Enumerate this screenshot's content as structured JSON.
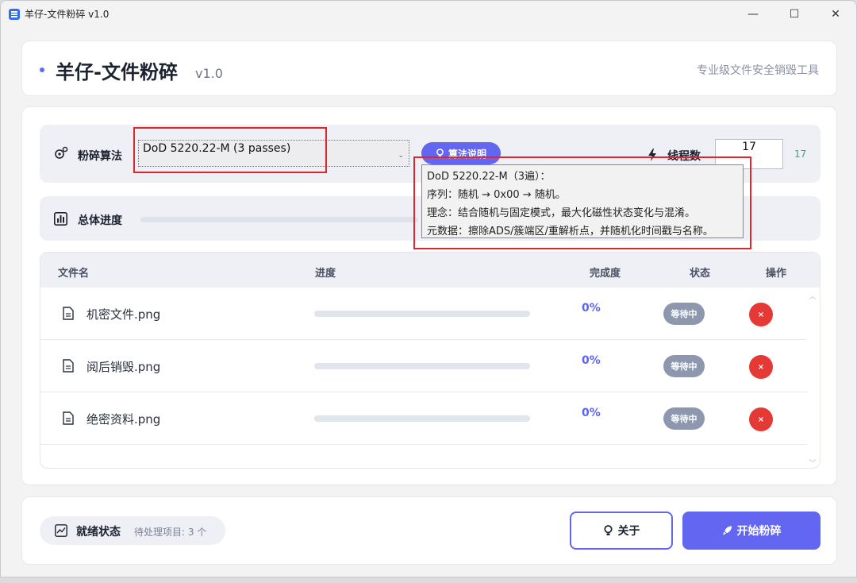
{
  "window": {
    "title": "羊仔-文件粉碎 v1.0",
    "controls": {
      "minimize": "—",
      "maximize": "☐",
      "close": "✕"
    }
  },
  "header": {
    "title": "羊仔-文件粉碎",
    "version": "v1.0",
    "subtitle": "专业级文件安全销毁工具"
  },
  "algorithm": {
    "label": "粉碎算法",
    "selected": "DoD 5220.22-M (3 passes)",
    "help_label": "算法说明",
    "tooltip": {
      "line1": "DoD 5220.22-M（3遍）：",
      "line2": "序列：随机 → 0x00 → 随机。",
      "line3": "理念：结合随机与固定模式，最大化磁性状态变化与混淆。",
      "line4": "元数据：擦除ADS/簇端区/重解析点，并随机化时间戳与名称。"
    }
  },
  "threads": {
    "label": "线程数",
    "input_value": "17",
    "display_value": "17",
    "value_color": "#2fae6c"
  },
  "overall_progress": {
    "label": "总体进度",
    "percent": 0
  },
  "table": {
    "headers": {
      "filename": "文件名",
      "progress": "进度",
      "completion": "完成度",
      "status": "状态",
      "action": "操作"
    },
    "rows": [
      {
        "name": "机密文件.png",
        "progress": 0,
        "percent": "0%",
        "status": "等待中",
        "delete": "×"
      },
      {
        "name": "阅后销毁.png",
        "progress": 0,
        "percent": "0%",
        "status": "等待中",
        "delete": "×"
      },
      {
        "name": "绝密资料.png",
        "progress": 0,
        "percent": "0%",
        "status": "等待中",
        "delete": "×"
      }
    ]
  },
  "footer": {
    "status_label": "就绪状态",
    "status_text": "待处理项目: 3 个",
    "about_label": "关于",
    "start_label": "开始粉碎"
  },
  "colors": {
    "accent": "#6366f1",
    "danger": "#e53935",
    "highlight_box": "#e0262a",
    "badge": "#8d98ae"
  }
}
